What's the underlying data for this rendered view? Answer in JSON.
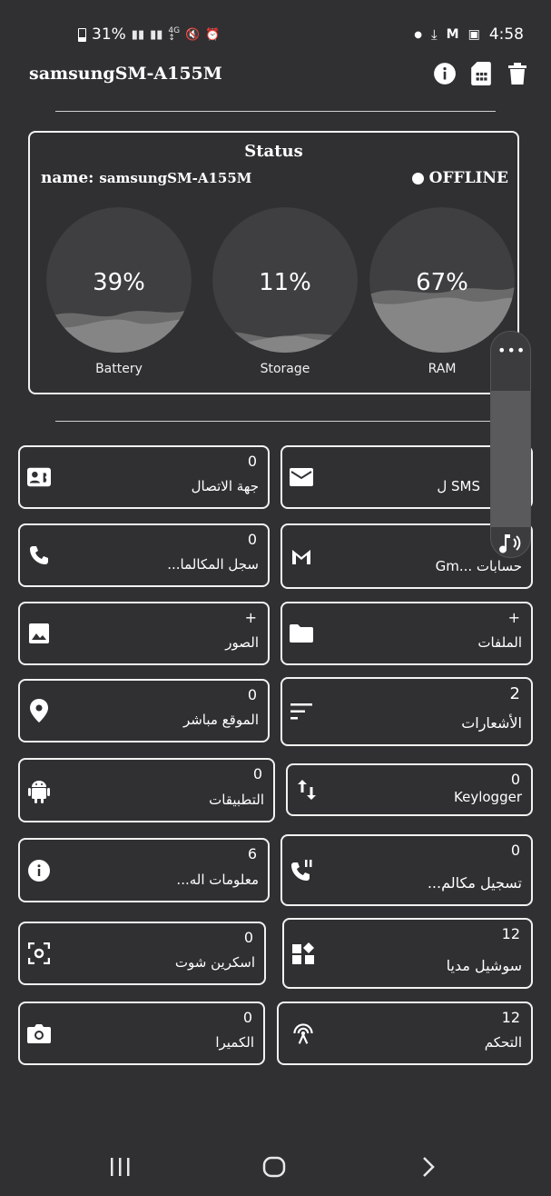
{
  "status_bar": {
    "battery": "31%",
    "time": "4:58"
  },
  "header": {
    "title": "samsungSM-A155M",
    "icons": [
      "info-icon",
      "sim-card-icon",
      "trash-icon"
    ]
  },
  "status_card": {
    "title": "Status",
    "name_label": "name:",
    "name_value": "samsungSM-A155M",
    "state": "OFFLINE",
    "gauges": [
      {
        "label": "Battery",
        "value": "39%",
        "fill": 0.39
      },
      {
        "label": "Storage",
        "value": "11%",
        "fill": 0.11
      },
      {
        "label": "RAM",
        "value": "67%",
        "fill": 0.67
      }
    ]
  },
  "tiles": [
    {
      "count": "0",
      "label": "جهة الاتصال",
      "icon": "contact-card-icon"
    },
    {
      "count": "",
      "label": "SMS ل",
      "icon": "mail-icon"
    },
    {
      "count": "0",
      "label": "سجل المكالما...",
      "icon": "phone-icon"
    },
    {
      "count": "",
      "label": "حسابات ...Gm",
      "icon": "gmail-icon"
    },
    {
      "count": "+",
      "label": "الصور",
      "icon": "image-icon"
    },
    {
      "count": "+",
      "label": "الملفات",
      "icon": "folder-icon"
    },
    {
      "count": "0",
      "label": "الموقع مباشر",
      "icon": "location-pin-icon"
    },
    {
      "count": "2",
      "label": "الأشعارات",
      "icon": "sort-lines-icon"
    },
    {
      "count": "0",
      "label": "التطبيقات",
      "icon": "android-icon"
    },
    {
      "count": "0",
      "label": "Keylogger",
      "icon": "swap-vertical-icon"
    },
    {
      "count": "6",
      "label": "معلومات اله...",
      "icon": "info-circle-icon"
    },
    {
      "count": "0",
      "label": "تسجيل مكالم...",
      "icon": "phone-paused-icon"
    },
    {
      "count": "0",
      "label": "اسكرين شوت",
      "icon": "screenshot-icon"
    },
    {
      "count": "12",
      "label": "سوشيل مديا",
      "icon": "widgets-icon"
    },
    {
      "count": "0",
      "label": "الكميرا",
      "icon": "camera-icon"
    },
    {
      "count": "12",
      "label": "التحكم",
      "icon": "antenna-icon"
    }
  ],
  "volume_panel": {
    "icons": [
      "more-dots-icon",
      "media-volume-icon"
    ]
  },
  "nav_bar": {
    "icons": [
      "recents-icon",
      "home-icon",
      "back-icon"
    ]
  }
}
